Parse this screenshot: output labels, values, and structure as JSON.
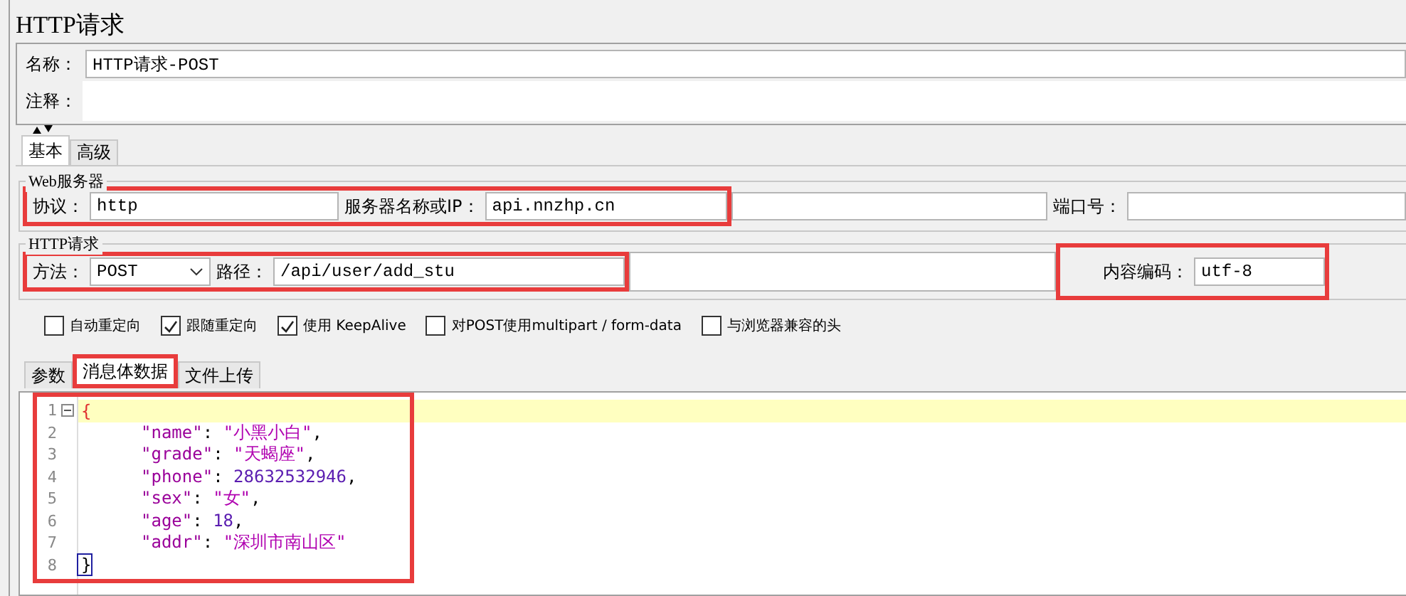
{
  "title": "HTTP请求",
  "name_field": {
    "label": "名称：",
    "value": "HTTP请求-POST"
  },
  "comment_field": {
    "label": "注释："
  },
  "tabs": [
    {
      "label": "基本",
      "selected": true
    },
    {
      "label": "高级",
      "selected": false
    }
  ],
  "web_server": {
    "legend": "Web服务器",
    "protocol_label": "协议：",
    "protocol": "http",
    "server_label": "服务器名称或IP：",
    "server": "api.nnzhp.cn",
    "port_label": "端口号："
  },
  "http_request": {
    "legend": "HTTP请求",
    "method_label": "方法：",
    "method": "POST",
    "path_label": "路径：",
    "path": "/api/user/add_stu",
    "encoding_label": "内容编码：",
    "encoding": "utf-8"
  },
  "options": [
    {
      "label": "自动重定向",
      "checked": false
    },
    {
      "label": "跟随重定向",
      "checked": true
    },
    {
      "label": "使用 KeepAlive",
      "checked": true
    },
    {
      "label": "对POST使用multipart / form-data",
      "checked": false
    },
    {
      "label": "与浏览器兼容的头",
      "checked": false
    }
  ],
  "body_tabs": [
    {
      "label": "参数",
      "selected": false
    },
    {
      "label": "消息体数据",
      "selected": true
    },
    {
      "label": "文件上传",
      "selected": false
    }
  ],
  "code_lines": [
    {
      "number": "1",
      "kind": "open",
      "text": "{",
      "current": true
    },
    {
      "number": "2",
      "kind": "pair",
      "tokens": [
        {
          "kind": "key",
          "text": "\"name\""
        },
        {
          "kind": "punct",
          "text": ": "
        },
        {
          "kind": "string",
          "text": "\"小黑小白\""
        },
        {
          "kind": "punct",
          "text": ","
        }
      ]
    },
    {
      "number": "3",
      "kind": "pair",
      "tokens": [
        {
          "kind": "key",
          "text": "\"grade\""
        },
        {
          "kind": "punct",
          "text": ": "
        },
        {
          "kind": "string",
          "text": "\"天蝎座\""
        },
        {
          "kind": "punct",
          "text": ","
        }
      ]
    },
    {
      "number": "4",
      "kind": "pair",
      "tokens": [
        {
          "kind": "key",
          "text": "\"phone\""
        },
        {
          "kind": "punct",
          "text": ": "
        },
        {
          "kind": "number",
          "text": "28632532946"
        },
        {
          "kind": "punct",
          "text": ","
        }
      ]
    },
    {
      "number": "5",
      "kind": "pair",
      "tokens": [
        {
          "kind": "key",
          "text": "\"sex\""
        },
        {
          "kind": "punct",
          "text": ": "
        },
        {
          "kind": "string",
          "text": "\"女\""
        },
        {
          "kind": "punct",
          "text": ","
        }
      ]
    },
    {
      "number": "6",
      "kind": "pair",
      "tokens": [
        {
          "kind": "key",
          "text": "\"age\""
        },
        {
          "kind": "punct",
          "text": ": "
        },
        {
          "kind": "number",
          "text": "18"
        },
        {
          "kind": "punct",
          "text": ","
        }
      ]
    },
    {
      "number": "7",
      "kind": "pair",
      "tokens": [
        {
          "kind": "key",
          "text": "\"addr\""
        },
        {
          "kind": "punct",
          "text": ": "
        },
        {
          "kind": "string",
          "text": "\"深圳市南山区\""
        }
      ]
    },
    {
      "number": "8",
      "kind": "close",
      "text": "}",
      "current": false
    }
  ]
}
